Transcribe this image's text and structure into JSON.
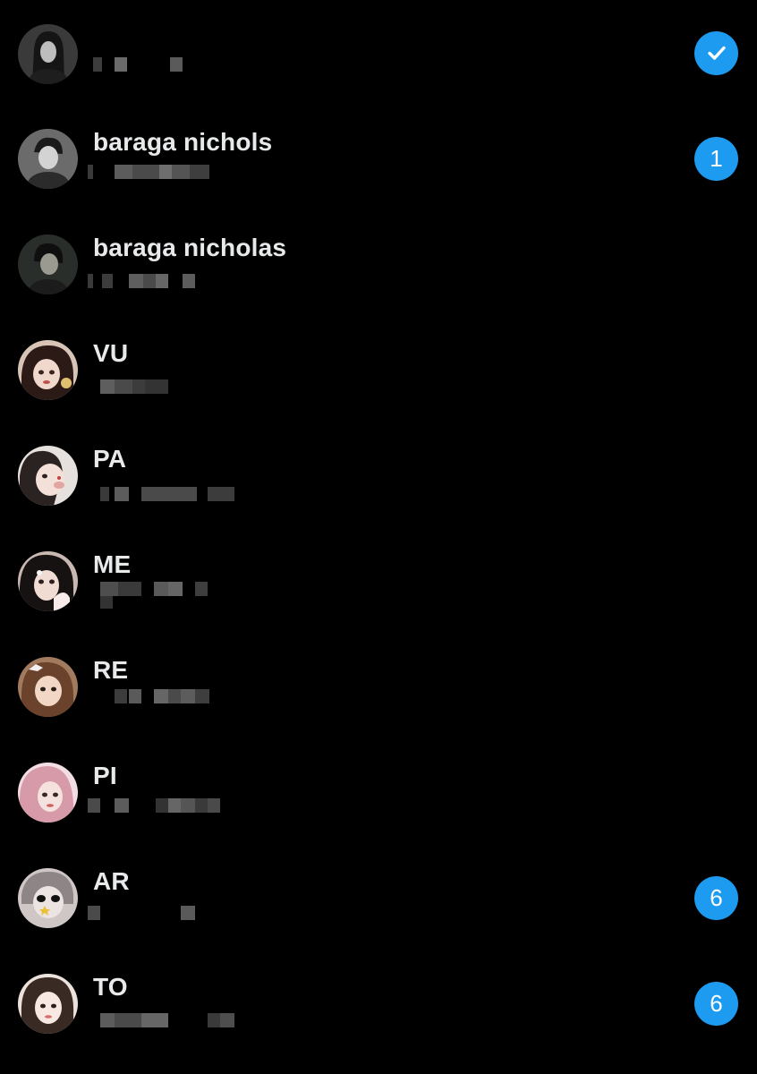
{
  "colors": {
    "background": "#000000",
    "text": "#e7e9ea",
    "badge": "#1d9bf0",
    "redacted": "#5a5a5a"
  },
  "conversations": [
    {
      "name": "",
      "badge_icon": "checkmark-icon",
      "badge_count": ""
    },
    {
      "name": "baraga nichols",
      "badge_icon": "",
      "badge_count": "1"
    },
    {
      "name": "baraga nicholas",
      "badge_icon": "",
      "badge_count": ""
    },
    {
      "name": "VU",
      "badge_icon": "",
      "badge_count": ""
    },
    {
      "name": "PA",
      "badge_icon": "",
      "badge_count": ""
    },
    {
      "name": "ME",
      "badge_icon": "",
      "badge_count": ""
    },
    {
      "name": "RE",
      "badge_icon": "",
      "badge_count": ""
    },
    {
      "name": "PI",
      "badge_icon": "",
      "badge_count": ""
    },
    {
      "name": "AR",
      "badge_icon": "",
      "badge_count": "6"
    },
    {
      "name": "TO",
      "badge_icon": "",
      "badge_count": "6"
    }
  ]
}
